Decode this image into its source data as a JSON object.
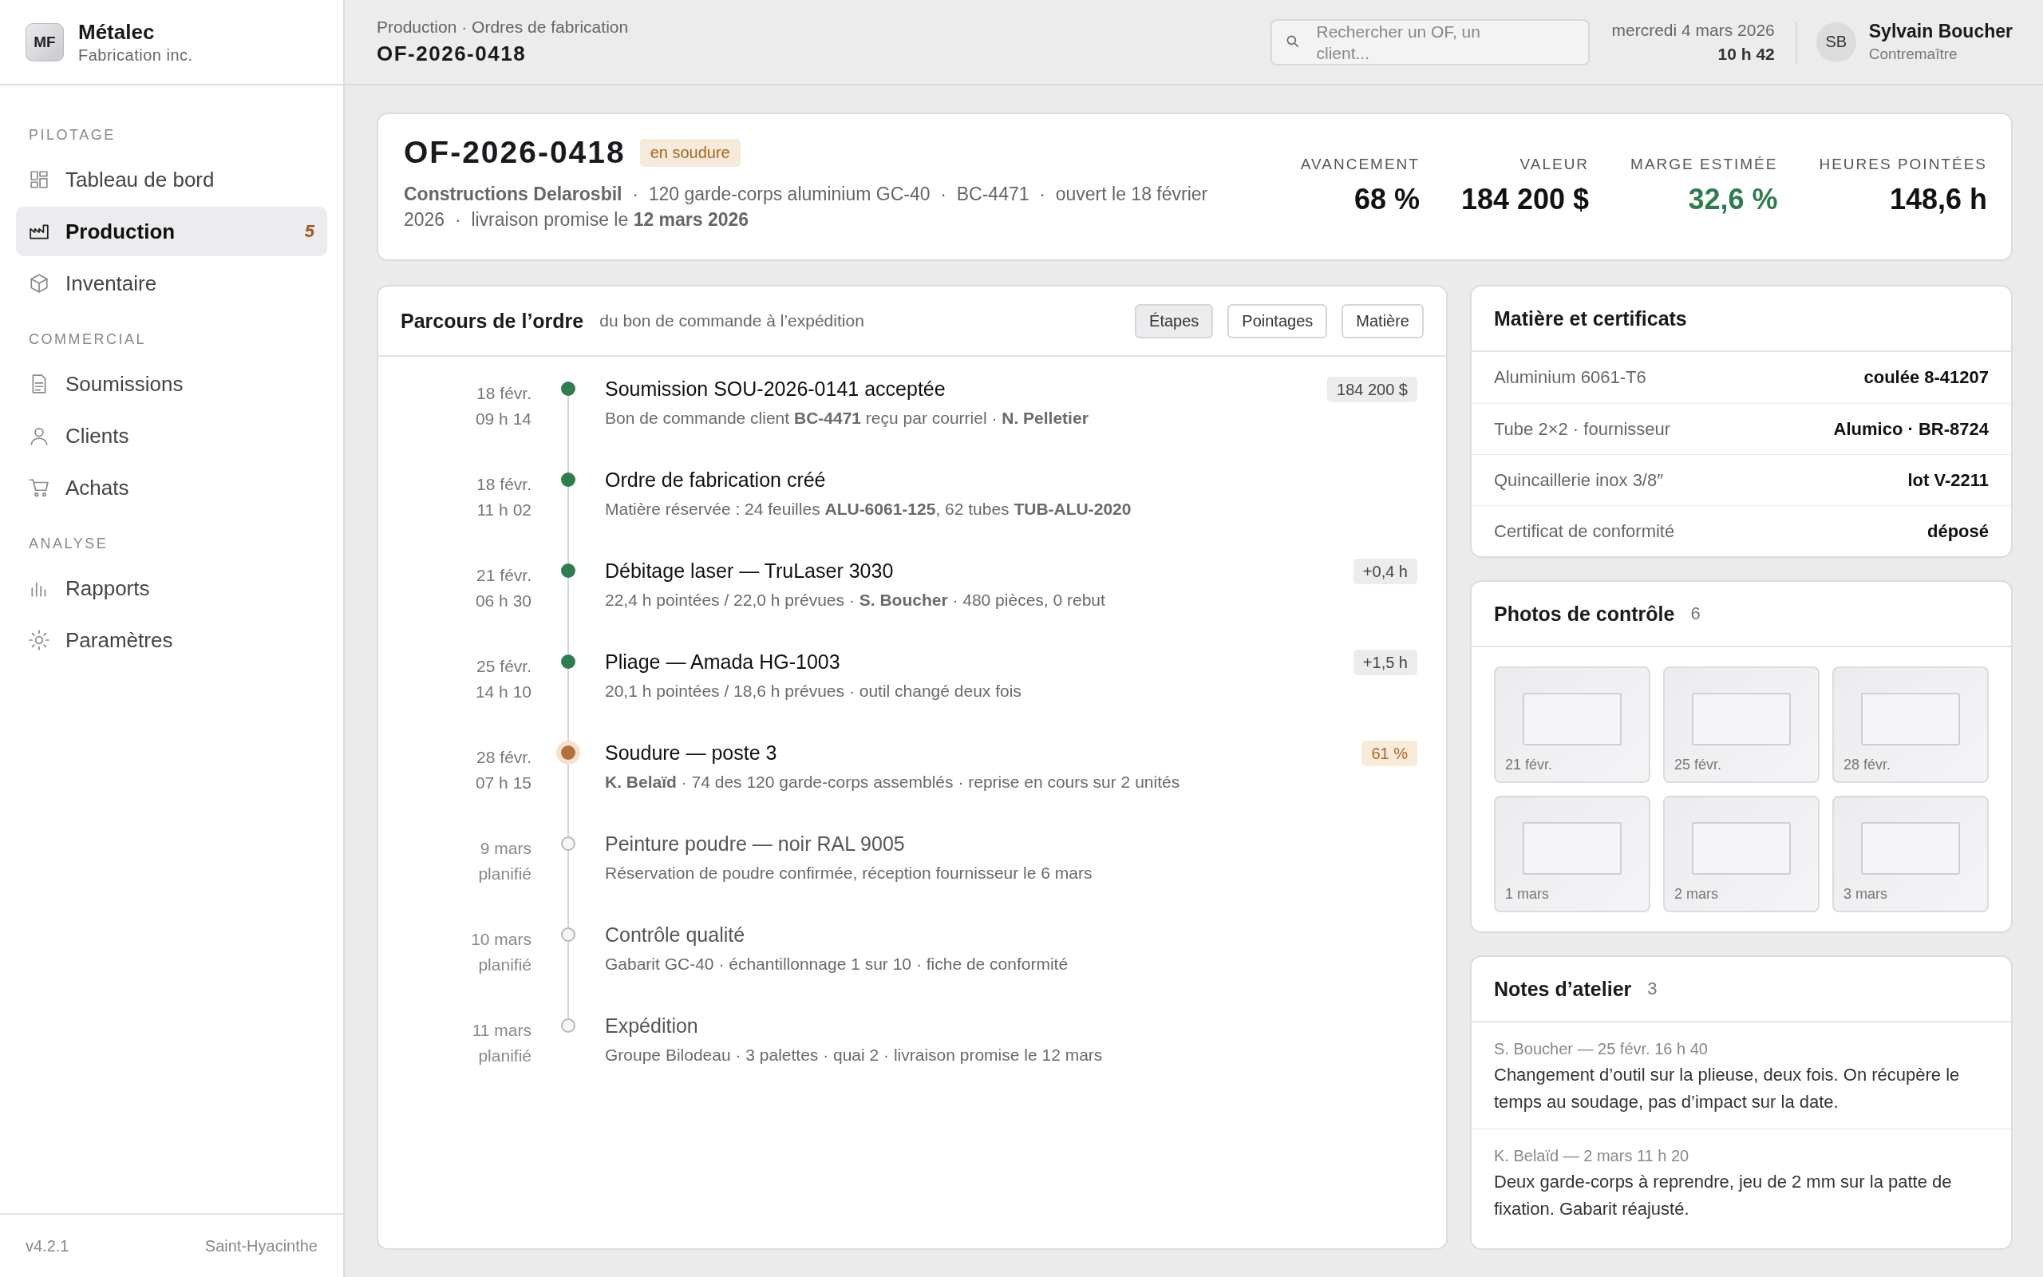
{
  "brand": {
    "initials": "MF",
    "name": "Métalec",
    "subtitle": "Fabrication inc."
  },
  "nav": [
    {
      "title": "PILOTAGE",
      "items": [
        {
          "label": "Tableau de bord",
          "kind": "dashboard",
          "selected": false
        },
        {
          "label": "Production",
          "kind": "factory",
          "selected": true,
          "badge": "5"
        },
        {
          "label": "Inventaire",
          "kind": "box",
          "selected": false
        }
      ]
    },
    {
      "title": "COMMERCIAL",
      "items": [
        {
          "label": "Soumissions",
          "kind": "document",
          "selected": false
        },
        {
          "label": "Clients",
          "kind": "person",
          "selected": false
        },
        {
          "label": "Achats",
          "kind": "cart",
          "selected": false
        }
      ]
    },
    {
      "title": "ANALYSE",
      "items": [
        {
          "label": "Rapports",
          "kind": "chart",
          "selected": false
        },
        {
          "label": "Paramètres",
          "kind": "gear",
          "selected": false
        }
      ]
    }
  ],
  "sidebar_footer": {
    "version": "v4.2.1",
    "location": "Saint-Hyacinthe"
  },
  "header": {
    "breadcrumb": "Production · Ordres de fabrication",
    "title": "OF-2026-0418",
    "search": {
      "placeholder": "Rechercher un OF, un client..."
    },
    "date": "mercredi 4 mars 2026",
    "time": "10 h 42",
    "user": {
      "initials": "SB",
      "name": "Sylvain Boucher",
      "role": "Contremaître"
    }
  },
  "order": {
    "id": "OF-2026-0418",
    "status": "en soudure",
    "meta": "**Constructions Delarosbil**  ·  120 garde-corps aluminium GC-40  ·  BC-4471  ·  ouvert le 18 février 2026  ·  livraison promise le **12 mars 2026**",
    "stats": [
      {
        "label": "AVANCEMENT",
        "value": "68 %",
        "positive": false
      },
      {
        "label": "VALEUR",
        "value": "184 200 $",
        "positive": false
      },
      {
        "label": "MARGE ESTIMÉE",
        "value": "32,6 %",
        "positive": true
      },
      {
        "label": "HEURES POINTÉES",
        "value": "148,6 h",
        "positive": false
      }
    ]
  },
  "timeline": {
    "title": "Parcours de l’ordre",
    "subtitle": "du bon de commande à l’expédition",
    "tabs": [
      {
        "label": "Étapes",
        "selected": true
      },
      {
        "label": "Pointages",
        "selected": false
      },
      {
        "label": "Matière",
        "selected": false
      }
    ],
    "steps": [
      {
        "date": "18 févr.",
        "time": "09 h 14",
        "title": "Soumission SOU-2026-0141 acceptée",
        "detail": "Bon de commande client **BC-4471** reçu par courriel · **N. Pelletier**",
        "kind": "done",
        "badge": "184 200 $",
        "warning": false
      },
      {
        "date": "18 févr.",
        "time": "11 h 02",
        "title": "Ordre de fabrication créé",
        "detail": "Matière réservée : 24 feuilles **ALU-6061-125**, 62 tubes **TUB-ALU-2020**",
        "kind": "done"
      },
      {
        "date": "21 févr.",
        "time": "06 h 30",
        "title": "Débitage laser — TruLaser 3030",
        "detail": "22,4 h pointées / 22,0 h prévues · **S. Boucher** · 480 pièces, 0 rebut",
        "kind": "done",
        "badge": "+0,4 h",
        "warning": false
      },
      {
        "date": "25 févr.",
        "time": "14 h 10",
        "title": "Pliage — Amada HG-1003",
        "detail": "20,1 h pointées / 18,6 h prévues · outil changé deux fois",
        "kind": "done",
        "badge": "+1,5 h",
        "warning": false
      },
      {
        "date": "28 févr.",
        "time": "07 h 15",
        "title": "Soudure — poste 3",
        "detail": "**K. Belaïd** · 74 des 120 garde-corps assemblés · reprise en cours sur 2 unités",
        "kind": "current",
        "badge": "61 %",
        "warning": true
      },
      {
        "date": "9 mars",
        "time": "planifié",
        "title": "Peinture poudre — noir RAL 9005",
        "detail": "Réservation de poudre confirmée, réception fournisseur le 6 mars",
        "kind": "planned"
      },
      {
        "date": "10 mars",
        "time": "planifié",
        "title": "Contrôle qualité",
        "detail": "Gabarit GC-40 · échantillonnage 1 sur 10 · fiche de conformité",
        "kind": "planned"
      },
      {
        "date": "11 mars",
        "time": "planifié",
        "title": "Expédition",
        "detail": "Groupe Bilodeau · 3 palettes · quai 2 · livraison promise le 12 mars",
        "kind": "planned"
      }
    ]
  },
  "materials": {
    "title": "Matière et certificats",
    "rows": [
      {
        "label": "Aluminium 6061-T6",
        "value": "coulée 8-41207"
      },
      {
        "label": "Tube 2×2 · fournisseur",
        "value": "Alumico · BR-8724"
      },
      {
        "label": "Quincaillerie inox 3/8″",
        "value": "lot V-2211"
      },
      {
        "label": "Certificat de conformité",
        "value": "déposé"
      }
    ]
  },
  "photos": {
    "title": "Photos de contrôle",
    "count": "6",
    "items": [
      {
        "caption": "21 févr."
      },
      {
        "caption": "25 févr."
      },
      {
        "caption": "28 févr."
      },
      {
        "caption": "1 mars"
      },
      {
        "caption": "2 mars"
      },
      {
        "caption": "3 mars"
      }
    ]
  },
  "notes": {
    "title": "Notes d’atelier",
    "count": "3",
    "items": [
      {
        "meta": "S. Boucher — 25 févr. 16 h 40",
        "text": "Changement d’outil sur la plieuse, deux fois. On récupère le temps au soudage, pas d’impact sur la date."
      },
      {
        "meta": "K. Belaïd — 2 mars 11 h 20",
        "text": "Deux garde-corps à reprendre, jeu de 2 mm sur la patte de fixation. Gabarit réajusté."
      }
    ]
  }
}
